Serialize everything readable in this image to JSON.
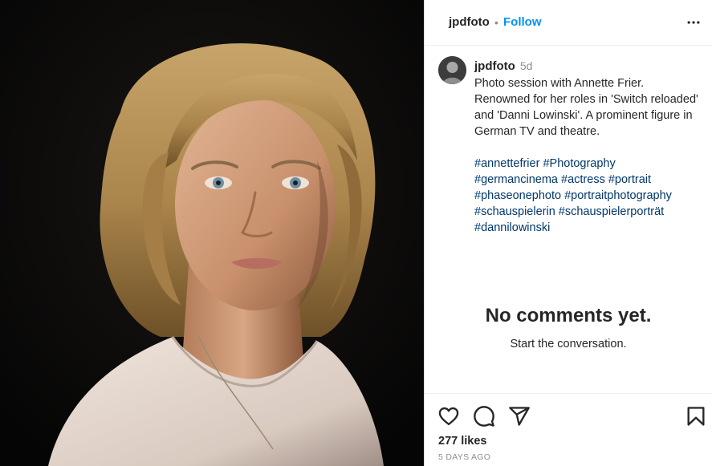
{
  "header": {
    "username": "jpdfoto",
    "separator": "•",
    "follow_label": "Follow",
    "more_icon": "more-horizontal-icon"
  },
  "caption": {
    "username": "jpdfoto",
    "time": "5d",
    "text": "Photo session with Annette Frier. Renowned for her roles in 'Switch reloaded' and 'Danni Lowinski'. A prominent figure in German TV and theatre.",
    "hashtags": [
      "#annettefrier",
      "#Photography",
      "#germancinema",
      "#actress",
      "#portrait",
      "#phaseonephoto",
      "#portraitphotography",
      "#schauspielerin",
      "#schauspielerporträt",
      "#dannilowinski"
    ]
  },
  "comments": {
    "empty_title": "No comments yet.",
    "empty_subtitle": "Start the conversation."
  },
  "actions": {
    "like_icon": "heart-icon",
    "comment_icon": "comment-icon",
    "share_icon": "send-icon",
    "save_icon": "bookmark-icon"
  },
  "stats": {
    "likes": "277 likes",
    "posted": "5 DAYS AGO"
  },
  "colors": {
    "link_blue": "#0095f6",
    "hashtag": "#00376b",
    "muted": "#8e8e8e",
    "text": "#262626"
  }
}
